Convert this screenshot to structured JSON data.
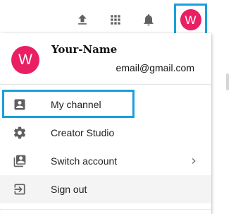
{
  "topbar": {
    "upload_icon": "upload-icon",
    "apps_icon": "apps-grid-icon",
    "notifications_icon": "bell-icon",
    "avatar_letter": "W",
    "avatar_color": "#e91e63",
    "highlight_color": "#1a9fdb"
  },
  "account": {
    "avatar_letter": "W",
    "name": "Your-Name",
    "email": "email@gmail.com"
  },
  "menu": {
    "items": [
      {
        "label": "My channel",
        "icon": "account-box-icon"
      },
      {
        "label": "Creator Studio",
        "icon": "gear-icon"
      },
      {
        "label": "Switch account",
        "icon": "switch-account-icon",
        "has_submenu": true
      },
      {
        "label": "Sign out",
        "icon": "sign-out-icon"
      }
    ]
  }
}
